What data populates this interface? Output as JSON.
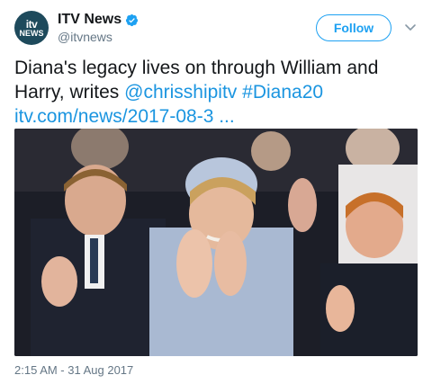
{
  "author": {
    "logo_line1": "itv",
    "logo_line2": "NEWS",
    "display_name": "ITV News",
    "handle": "@itvnews",
    "verified": true
  },
  "follow_label": "Follow",
  "tweet": {
    "text_plain": "Diana's legacy lives on through William and Harry, writes ",
    "mention": "@chrisshipitv",
    "hashtag": "#Diana20",
    "link": "itv.com/news/2017-08-3",
    "ellipsis": " ..."
  },
  "timestamp": "2:15 AM - 31 Aug 2017",
  "colors": {
    "brand_blue": "#1da1f2",
    "link_blue": "#1b95e0",
    "text": "#14171a",
    "secondary": "#657786"
  },
  "icons": {
    "verified": "verified-badge-icon",
    "caret": "chevron-down-icon"
  }
}
